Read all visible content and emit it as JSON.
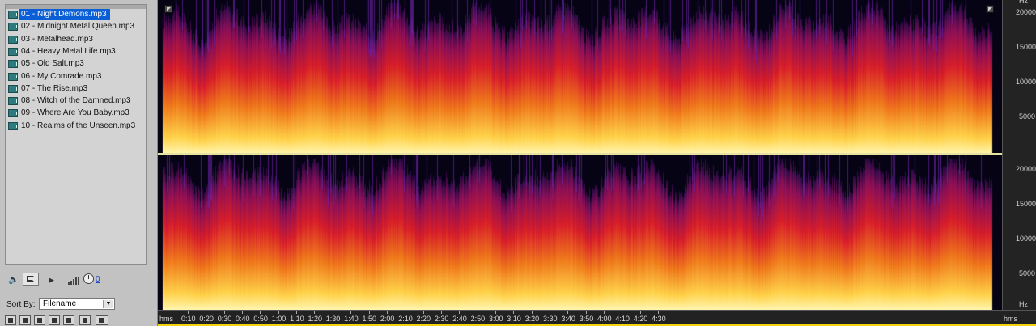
{
  "files": [
    {
      "label": "01 - Night Demons.mp3",
      "selected": true
    },
    {
      "label": "02 - Midnight Metal Queen.mp3",
      "selected": false
    },
    {
      "label": "03 - Metalhead.mp3",
      "selected": false
    },
    {
      "label": "04 - Heavy Metal Life.mp3",
      "selected": false
    },
    {
      "label": "05 - Old Salt.mp3",
      "selected": false
    },
    {
      "label": "06 - My Comrade.mp3",
      "selected": false
    },
    {
      "label": "07 - The Rise.mp3",
      "selected": false
    },
    {
      "label": "08 - Witch of the Damned.mp3",
      "selected": false
    },
    {
      "label": "09 - Where Are You Baby.mp3",
      "selected": false
    },
    {
      "label": "10 - Realms of the Unseen.mp3",
      "selected": false
    }
  ],
  "transport": {
    "volume_value": "0"
  },
  "sort": {
    "label": "Sort By:",
    "value": "Filename"
  },
  "hz_ruler": {
    "unit": "Hz",
    "top_channel": [
      "20000",
      "15000",
      "10000",
      "5000"
    ],
    "bottom_channel": [
      "20000",
      "15000",
      "10000",
      "5000"
    ]
  },
  "time_ruler": {
    "unit": "hms",
    "ticks": [
      "0:10",
      "0:20",
      "0:30",
      "0:40",
      "0:50",
      "1:00",
      "1:10",
      "1:20",
      "1:30",
      "1:40",
      "1:50",
      "2:00",
      "2:10",
      "2:20",
      "2:30",
      "2:40",
      "2:50",
      "3:00",
      "3:10",
      "3:20",
      "3:30",
      "3:40",
      "3:50",
      "4:00",
      "4:10",
      "4:20",
      "4:30"
    ],
    "end_label": "hms"
  },
  "colors": {
    "selection": "#0a5fd6",
    "playhead": "#f5d20e",
    "spectrum_low": "#fff19a",
    "spectrum_mid": "#e8261b",
    "spectrum_high": "#3a0f55"
  }
}
